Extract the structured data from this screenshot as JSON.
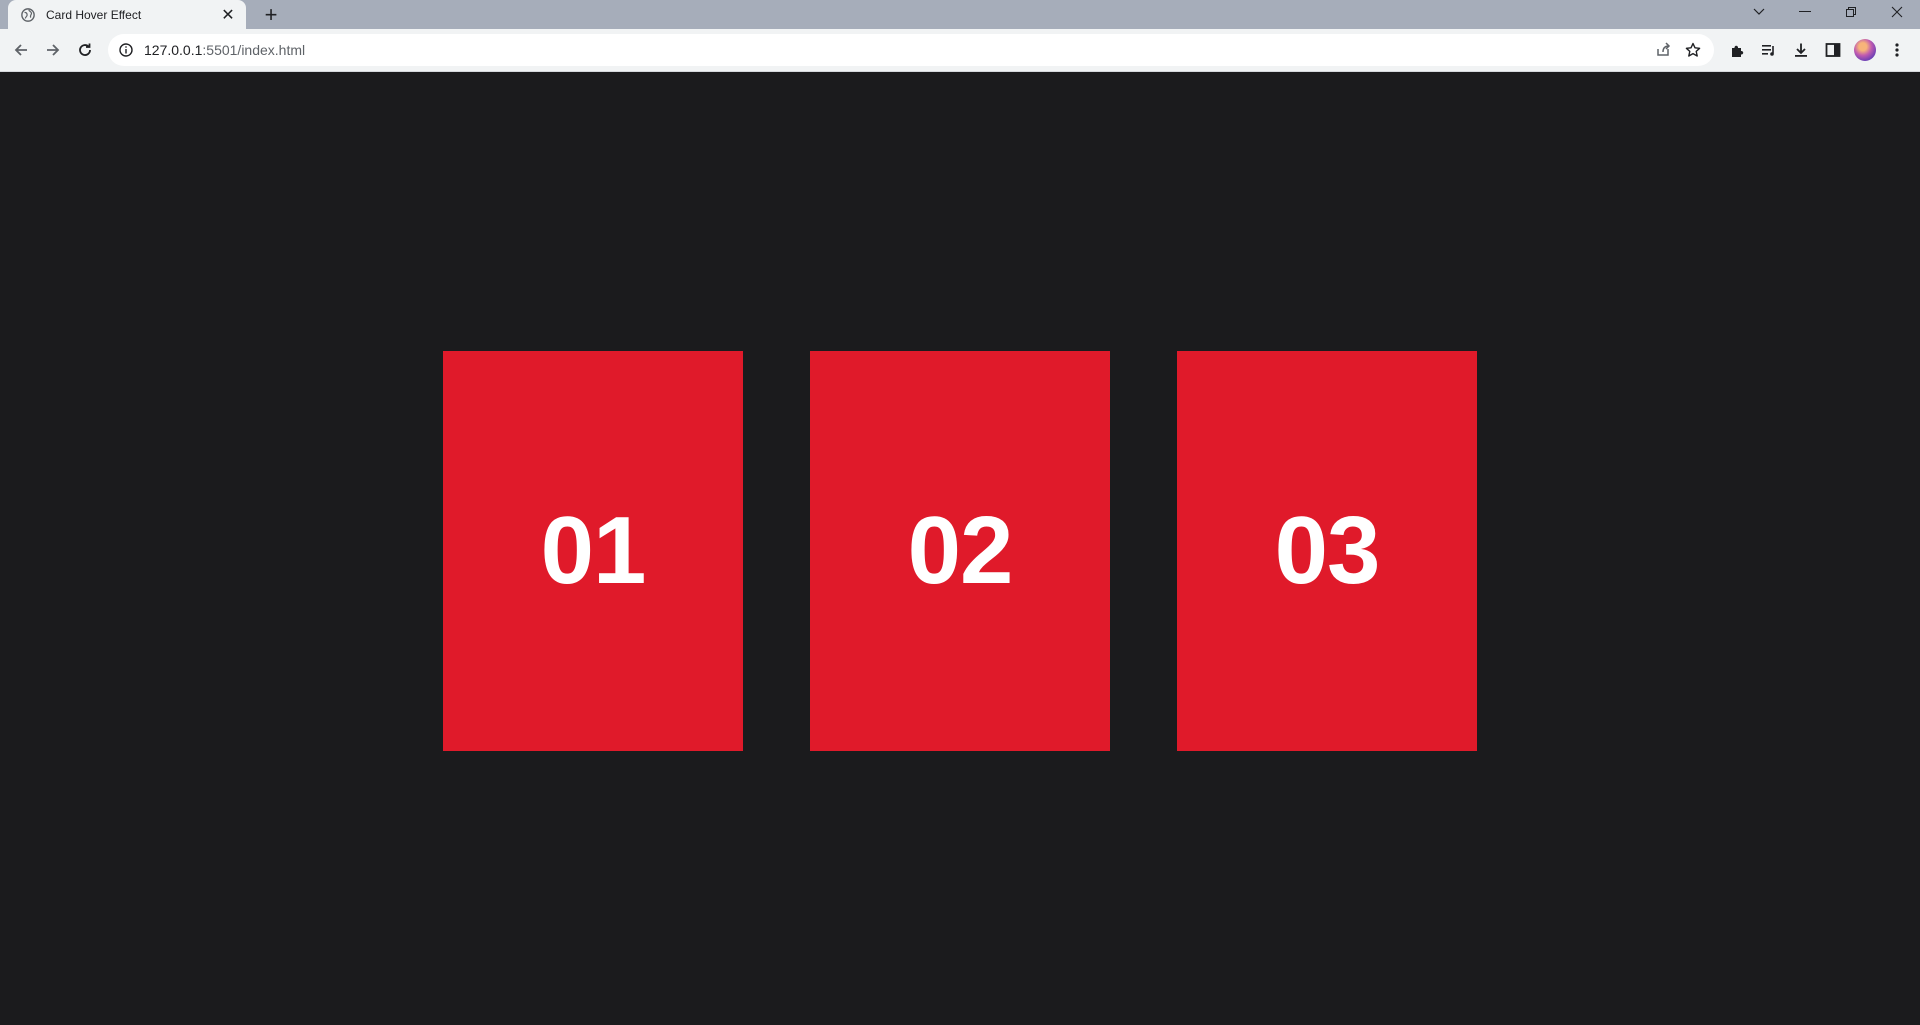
{
  "browser": {
    "tab": {
      "title": "Card Hover Effect"
    },
    "newtab_symbol": "+",
    "close_symbol": "✕",
    "address": {
      "host": "127.0.0.1",
      "path": ":5501/index.html"
    }
  },
  "cards": [
    {
      "label": "01"
    },
    {
      "label": "02"
    },
    {
      "label": "03"
    }
  ],
  "colors": {
    "page_background": "#1b1b1d",
    "card": "#e01a2a",
    "card_text": "#ffffff"
  },
  "icons": [
    "globe-icon",
    "close-icon",
    "plus-icon",
    "back-icon",
    "forward-icon",
    "reload-icon",
    "info-icon",
    "share-icon",
    "star-icon",
    "extensions-icon",
    "media-icon",
    "download-icon",
    "sidepanel-icon",
    "avatar",
    "menu-icon"
  ]
}
